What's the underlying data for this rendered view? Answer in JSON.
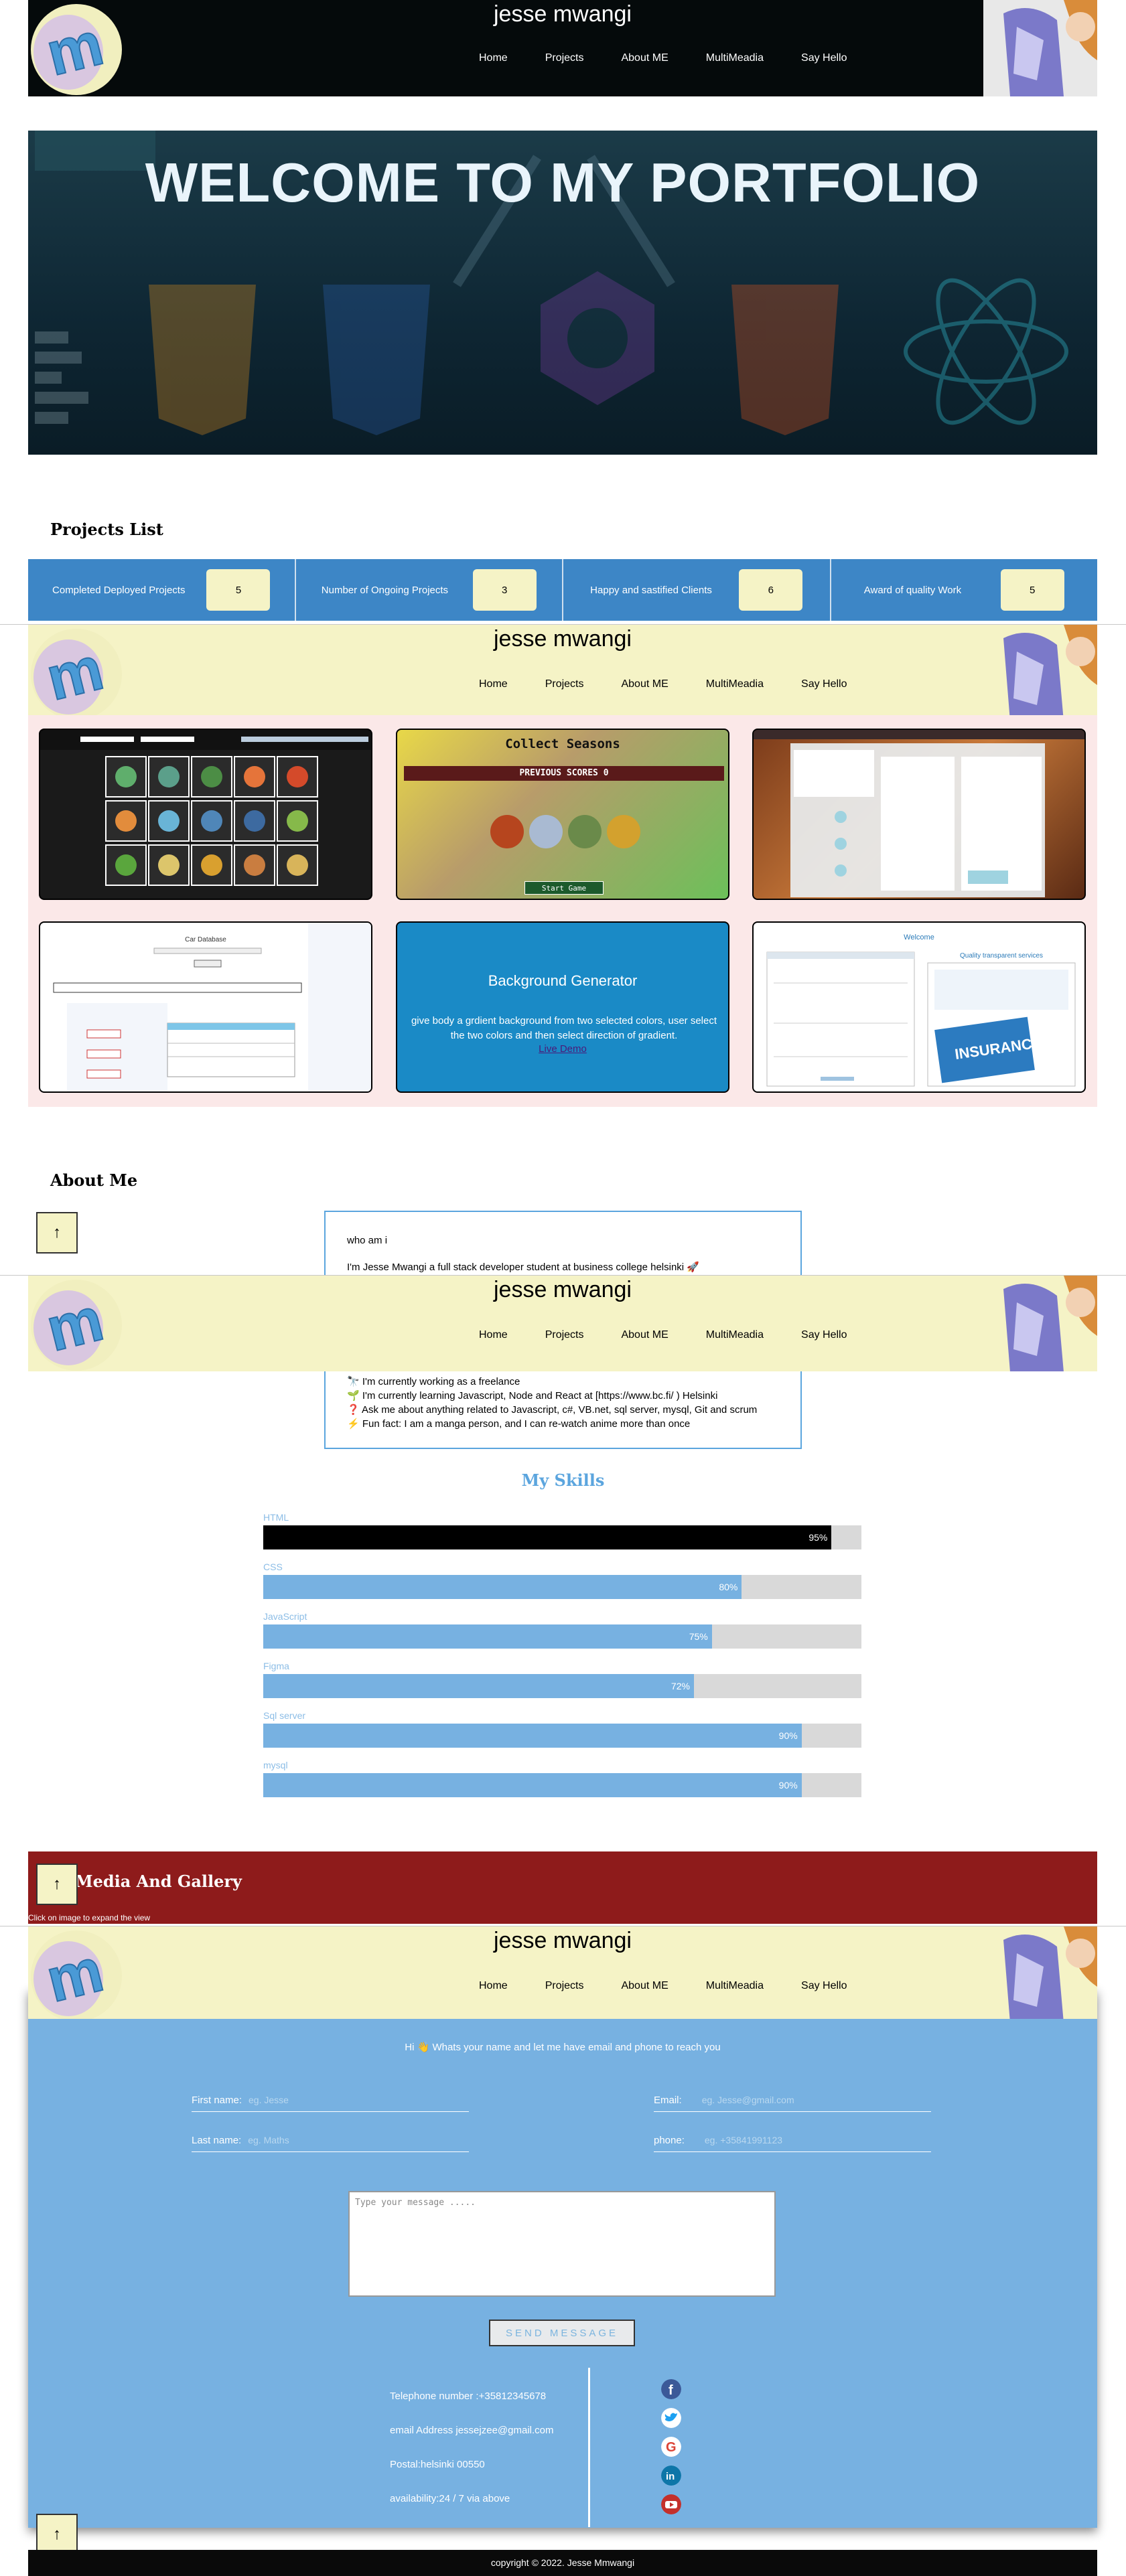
{
  "header": {
    "title": "jesse mwangi",
    "nav": [
      "Home",
      "Projects",
      "About ME",
      "MultiMeadia",
      "Say Hello"
    ]
  },
  "hero": {
    "title": "WELCOME TO MY PORTFOLIO"
  },
  "projects_list": {
    "heading": "Projects List",
    "stats": [
      {
        "label": "Completed Deployed Projects",
        "value": "5"
      },
      {
        "label": "Number of Ongoing Projects",
        "value": "3"
      },
      {
        "label": "Happy and sastified Clients",
        "value": "6"
      },
      {
        "label": "Award of quality Work",
        "value": "5"
      }
    ]
  },
  "project_cards": {
    "collect_title": "Collect Seasons",
    "collect_score": "PREVIOUS SCORES 0",
    "collect_button": "Start Game",
    "bg_title": "Background Generator",
    "bg_desc": "give body a grdient background from two selected colors, user select the two colors and then select direction of gradient.",
    "bg_link": "Live Demo",
    "insurance_welcome": "Welcome",
    "insurance_services": "Quality transparent services",
    "insurance_label": "INSURANCE",
    "car_title": "Car Database"
  },
  "about": {
    "heading": "About Me",
    "who": "who am i",
    "intro": "I'm Jesse Mwangi a full stack developer student at business college helsinki 🚀",
    "items": [
      "🔭 I'm currently working as a freelance",
      "🌱 I'm currently learning Javascript, Node and React at [https://www.bc.fi/ ) Helsinki",
      "❓ Ask me about anything related to Javascript, c#, VB.net, sql server, mysql, Git and scrum",
      "⚡ Fun fact: I am a manga person, and I can re-watch anime more than once"
    ]
  },
  "skills": {
    "heading": "My Skills",
    "items": [
      {
        "name": "HTML",
        "percent": 95,
        "label": "95%"
      },
      {
        "name": "CSS",
        "percent": 80,
        "label": "80%"
      },
      {
        "name": "JavaScript",
        "percent": 75,
        "label": "75%"
      },
      {
        "name": "Figma",
        "percent": 72,
        "label": "72%"
      },
      {
        "name": "Sql server",
        "percent": 90,
        "label": "90%"
      },
      {
        "name": "mysql",
        "percent": 90,
        "label": "90%"
      }
    ]
  },
  "media": {
    "heading": "Media And Gallery",
    "note": "Click on image to expand the view"
  },
  "contact": {
    "greeting": "Hi 👋 Whats your name and let me have email and phone to reach you",
    "first_name_label": "First name:",
    "first_name_placeholder": "eg. Jesse",
    "last_name_label": "Last name:",
    "last_name_placeholder": "eg. Maths",
    "email_label": "Email:",
    "email_placeholder": "eg. Jesse@gmail.com",
    "phone_label": "phone:",
    "phone_placeholder": "eg. +35841991123",
    "message_placeholder": "Type your message .....",
    "send_label": "SEND MESSAGE",
    "telephone": "Telephone number :+35812345678",
    "email": "email Address  jessejzee@gmail.com",
    "postal": "Postal:helsinki 00550",
    "availability": "availability:24 / 7 via above"
  },
  "footer": {
    "copyright": "copyright © 2022. Jesse Mmwangi"
  },
  "icons": {
    "back_to_top": "arrow-up-icon",
    "social": [
      "facebook-icon",
      "twitter-icon",
      "google-icon",
      "linkedin-icon",
      "youtube-icon"
    ]
  },
  "colors": {
    "accent_blue": "#3d86c6",
    "cream": "#f5f3c6",
    "skill_bar": "#77b1e1",
    "media_red": "#8e1b1b"
  }
}
